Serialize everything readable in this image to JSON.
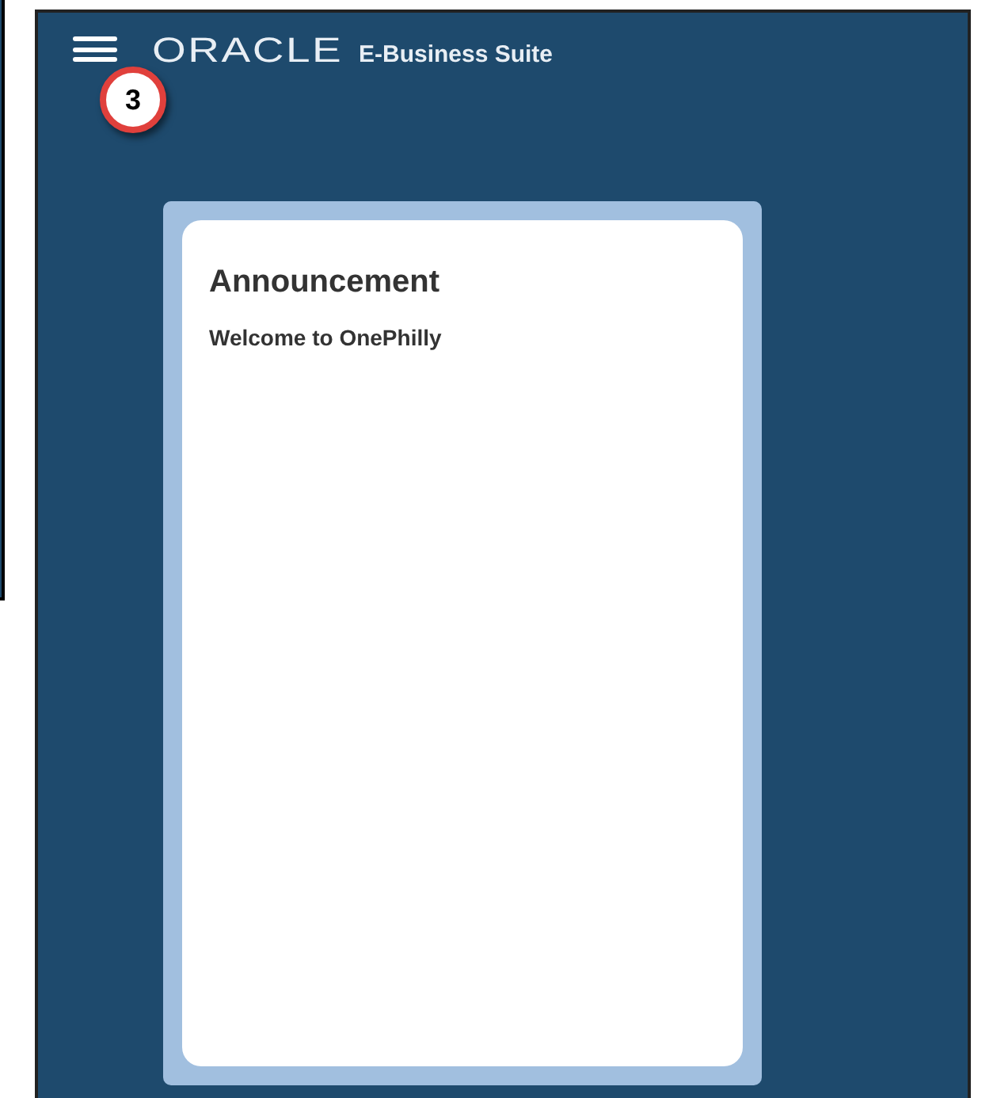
{
  "header": {
    "logo": "ORACLE",
    "product": "E-Business Suite"
  },
  "callout": {
    "number": "3"
  },
  "announcement": {
    "title": "Announcement",
    "message": "Welcome to OnePhilly"
  }
}
